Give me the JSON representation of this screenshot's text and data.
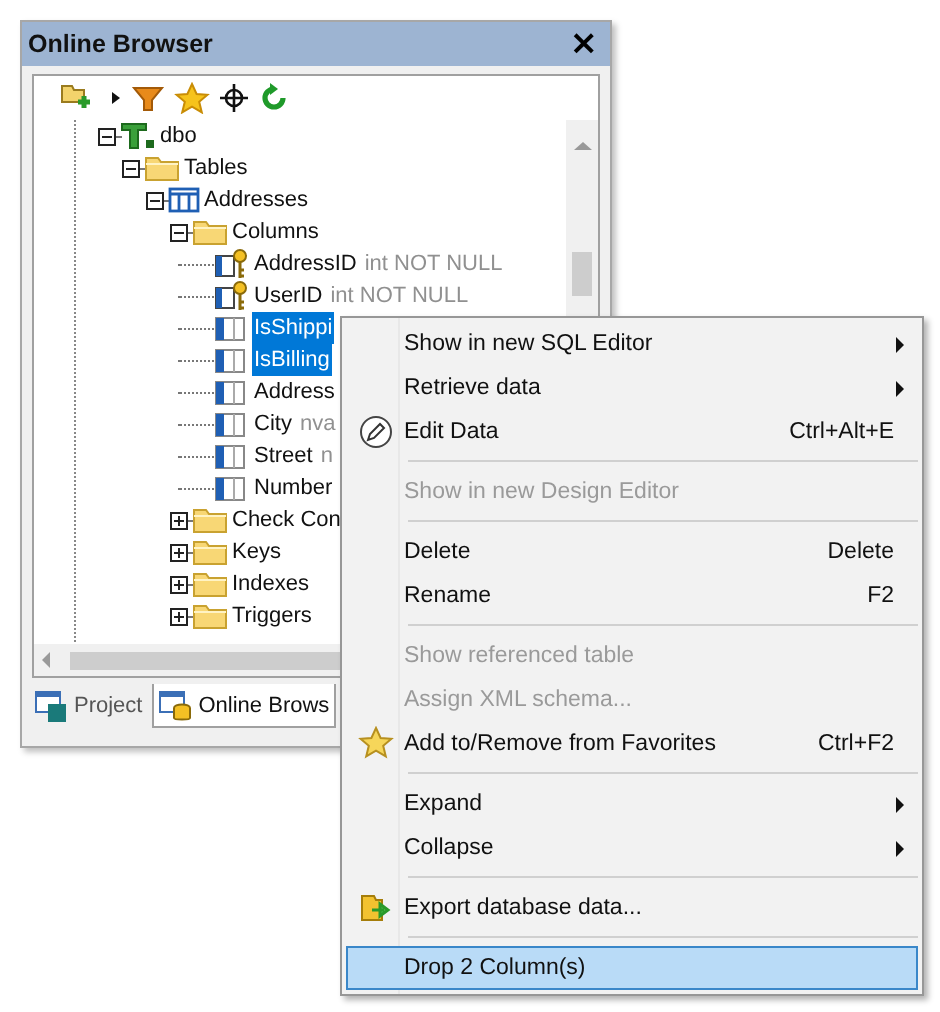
{
  "panel": {
    "title": "Online Browser",
    "close": "×"
  },
  "tree": [
    {
      "label": "dbo",
      "kind": "schema",
      "expanded": true,
      "selected": false,
      "children": [
        {
          "label": "Tables",
          "kind": "folder",
          "expanded": true,
          "selected": false,
          "children": [
            {
              "label": "Addresses",
              "kind": "table",
              "expanded": true,
              "selected": false,
              "children": [
                {
                  "label": "Columns",
                  "kind": "folder",
                  "expanded": true,
                  "selected": false,
                  "children": [
                    {
                      "label": "AddressID",
                      "type": "int NOT NULL",
                      "kind": "key-column",
                      "selected": false
                    },
                    {
                      "label": "UserID",
                      "type": "int NOT NULL",
                      "kind": "key-column",
                      "selected": false
                    },
                    {
                      "label": "IsShippi",
                      "kind": "column",
                      "selected": true
                    },
                    {
                      "label": "IsBilling",
                      "kind": "column",
                      "selected": true
                    },
                    {
                      "label": "Address",
                      "kind": "column",
                      "selected": false
                    },
                    {
                      "label": "City",
                      "type": "nva",
                      "kind": "column",
                      "selected": false
                    },
                    {
                      "label": "Street",
                      "type": "n",
                      "kind": "column",
                      "selected": false
                    },
                    {
                      "label": "Number",
                      "kind": "column",
                      "selected": false
                    }
                  ]
                },
                {
                  "label": "Check Con",
                  "kind": "folder",
                  "expanded": false,
                  "selected": false
                },
                {
                  "label": "Keys",
                  "kind": "folder",
                  "expanded": false,
                  "selected": false
                },
                {
                  "label": "Indexes",
                  "kind": "folder",
                  "expanded": false,
                  "selected": false
                },
                {
                  "label": "Triggers",
                  "kind": "folder",
                  "expanded": false,
                  "selected": false
                }
              ]
            }
          ]
        }
      ]
    }
  ],
  "tabs": [
    {
      "label": "Project",
      "kind": "project",
      "selected": false
    },
    {
      "label": "Online Brows",
      "kind": "browser",
      "selected": true
    }
  ],
  "context_menu": [
    {
      "kind": "item",
      "label": "Show in new SQL Editor",
      "submenu": true,
      "disabled": false,
      "selected": false
    },
    {
      "kind": "item",
      "label": "Retrieve data",
      "submenu": true,
      "disabled": false,
      "selected": false
    },
    {
      "kind": "edit",
      "label": "Edit Data",
      "shortcut": "Ctrl+Alt+E",
      "disabled": false,
      "selected": false
    },
    {
      "kind": "separator"
    },
    {
      "kind": "item",
      "label": "Show in new Design Editor",
      "disabled": true,
      "selected": false
    },
    {
      "kind": "separator"
    },
    {
      "kind": "item",
      "label": "Delete",
      "shortcut": "Delete",
      "disabled": false,
      "selected": false
    },
    {
      "kind": "item",
      "label": "Rename",
      "shortcut": "F2",
      "disabled": false,
      "selected": false
    },
    {
      "kind": "separator"
    },
    {
      "kind": "item",
      "label": "Show referenced table",
      "disabled": true,
      "selected": false
    },
    {
      "kind": "item",
      "label": "Assign XML schema...",
      "disabled": true,
      "selected": false
    },
    {
      "kind": "favorite",
      "label": "Add to/Remove from Favorites",
      "shortcut": "Ctrl+F2",
      "disabled": false,
      "selected": false
    },
    {
      "kind": "separator"
    },
    {
      "kind": "item",
      "label": "Expand",
      "submenu": true,
      "disabled": false,
      "selected": false
    },
    {
      "kind": "item",
      "label": "Collapse",
      "submenu": true,
      "disabled": false,
      "selected": false
    },
    {
      "kind": "separator"
    },
    {
      "kind": "export",
      "label": "Export database data...",
      "disabled": false,
      "selected": false
    },
    {
      "kind": "separator"
    },
    {
      "kind": "item",
      "label": "Drop 2 Column(s)",
      "disabled": false,
      "selected": true
    }
  ]
}
